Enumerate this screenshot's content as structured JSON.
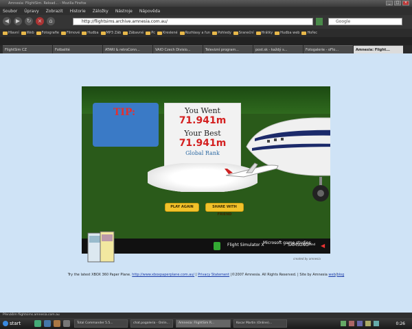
{
  "window": {
    "title": "Amnesia: FlightSim. Reload... - Mozilla Firefox",
    "controls": [
      "_",
      "□",
      "×"
    ]
  },
  "menu": [
    "Soubor",
    "Úpravy",
    "Zobrazit",
    "Historie",
    "Záložky",
    "Nástroje",
    "Nápověda"
  ],
  "navigation": {
    "url": "http://flightsims.archive.amnesia.com.au/",
    "search_placeholder": "Google"
  },
  "bookmarks": [
    "Hlavní",
    "Web",
    "Fotografie",
    "Filmové",
    "Hudba",
    "MP3 Záb",
    "Zábavné",
    "Pc",
    "Kreslené",
    "Rozhlasy a fun",
    "Pohledy",
    "Sraneční",
    "Hrátky",
    "Hudba web",
    "Hořec"
  ],
  "tabs": [
    {
      "label": "FlightSim CZ",
      "active": false
    },
    {
      "label": "Fotbalité",
      "active": false
    },
    {
      "label": "ATARI & retroConn...",
      "active": false
    },
    {
      "label": "VAIO Czech Divisio...",
      "active": false
    },
    {
      "label": "Televizní program...",
      "active": false
    },
    {
      "label": "post.sk - každý s...",
      "active": false
    },
    {
      "label": "Fotogalerie - oFlo...",
      "active": false
    },
    {
      "label": "Amnesia: Flight...",
      "active": true
    }
  ],
  "game": {
    "tip_label": "TIP:",
    "you_went_label": "You Went",
    "you_went_value": "71.941m",
    "your_best_label": "Your Best",
    "your_best_value": "71.941m",
    "global_rank_label": "Global Rank",
    "global_rank_value": "-",
    "play_again": "PLAY AGAIN",
    "share": "SHARE WITH FRIEND",
    "created_by": "created by amnesia",
    "logos": [
      "Flight Simulator X",
      "Microsoft game studios",
      "SAMSUNG",
      "Windows"
    ]
  },
  "footer": {
    "prefix": "Try the latest XBOX 360 Paper Plane.",
    "xbox_link": "http://www.xboxpaperplane.com.au/",
    "privacy": "Privacy Statement",
    "copyright": "|©2007 Amnesia. All Rights Reserved. | Site by Amnesia",
    "web": "web",
    "blog": "blog"
  },
  "status": "Přenáším flightsims.amnesia.com.au",
  "taskbar": {
    "start": "start",
    "tasks": [
      {
        "label": "Total Commander 5.5...",
        "active": false
      },
      {
        "label": "chat.pogaleria - Onlin...",
        "active": false
      },
      {
        "label": "Amnesia: FlightSim R...",
        "active": true
      },
      {
        "label": "Kocar Martin (Online)...",
        "active": false
      }
    ],
    "clock": "0:26"
  },
  "colors": {
    "page_bg": "#cfe3f6",
    "game_bg": "#2a5a1a",
    "tip_red": "#e23030",
    "value_red": "#d42020",
    "button_yellow": "#f2c22a",
    "link_blue": "#1a3aa8"
  }
}
